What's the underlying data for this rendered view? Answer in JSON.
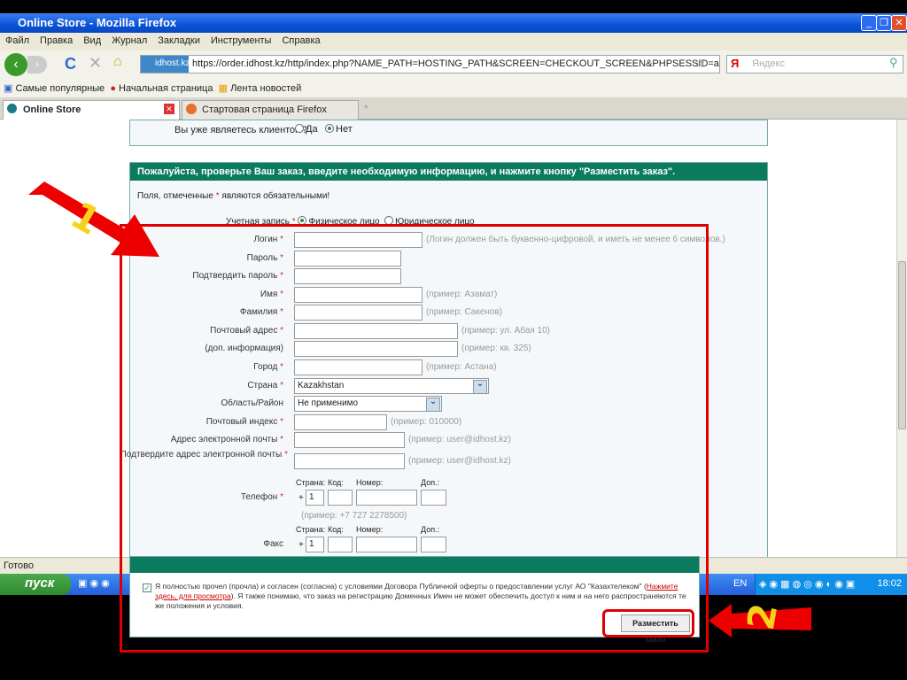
{
  "window": {
    "title": "Online Store - Mozilla Firefox"
  },
  "menu": [
    "Файл",
    "Правка",
    "Вид",
    "Журнал",
    "Закладки",
    "Инструменты",
    "Справка"
  ],
  "nav": {
    "site_badge": "idhost.kz",
    "url": "https://order.idhost.kz/http/index.php?NAME_PATH=HOSTING_PATH&SCREEN=CHECKOUT_SCREEN&PHPSESSID=afbb8387bcd36a9a3d8f16e11",
    "search_placeholder": "Яндекс",
    "search_engine": "Я"
  },
  "bookmarks": [
    "Самые популярные",
    "Начальная страница",
    "Лента новостей"
  ],
  "tabs": [
    "Online Store",
    "Стартовая страница Firefox"
  ],
  "client": {
    "question": "Вы уже являетесь клиентом?",
    "yes": "Да",
    "no": "Нет",
    "selected": "Нет"
  },
  "form": {
    "header": "Пожалуйста, проверьте Ваш заказ, введите необходимую информацию, и нажмите кнопку \"Разместить заказ\".",
    "required_note_pre": "Поля, отмеченные ",
    "required_note_star": "*",
    "required_note_post": " являются обязательными!",
    "account_label": "Учетная запись",
    "account_individual": "Физическое лицо",
    "account_company": "Юридическое лицо",
    "fields": [
      {
        "label": "Логин",
        "req": true,
        "hint": "(Логин должен быть буквенно-цифровой, и иметь не менее 6 символов.)"
      },
      {
        "label": "Пароль",
        "req": true,
        "hint": ""
      },
      {
        "label": "Подтвердить пароль",
        "req": true,
        "hint": ""
      },
      {
        "label": "Имя",
        "req": true,
        "hint": "(пример: Азамат)"
      },
      {
        "label": "Фамилия",
        "req": true,
        "hint": "(пример: Сакенов)"
      },
      {
        "label": "Почтовый адрес",
        "req": true,
        "hint": "(пример: ул. Абая 10)"
      },
      {
        "label": "(доп. информация)",
        "req": false,
        "hint": "(пример: кв. 325)"
      },
      {
        "label": "Город",
        "req": true,
        "hint": "(пример: Астана)"
      },
      {
        "label": "Страна",
        "req": true,
        "value": "Kazakhstan",
        "hint": ""
      },
      {
        "label": "Область/Район",
        "req": false,
        "value": "Не применимо",
        "hint": ""
      },
      {
        "label": "Почтовый индекс",
        "req": true,
        "hint": "(пример: 010000)"
      },
      {
        "label": "Адрес электронной почты",
        "req": true,
        "hint": "(пример: user@idhost.kz)"
      },
      {
        "label": "Подтвердите адрес электронной почты",
        "req": true,
        "hint": "(пример: user@idhost.kz)"
      }
    ],
    "phone_cols": [
      "Страна:",
      "Код:",
      "Номер:",
      "Доп.:"
    ],
    "phone_label": "Телефон",
    "fax_label": "Факс",
    "plus": "+",
    "country_code": "1",
    "phone_hint": "(пример: +7 727 2278500)"
  },
  "agreement": {
    "text1": "Я полностью прочел (прочла) и согласен (согласна) с условиями Договора Публичной оферты о предоставлении услуг АО \"Казахтелеком\" (",
    "link": "Нажмите здесь, для просмотра",
    "text2": "). Я также понимаю, что заказ на регистрацию Доменных Имен не может обеспечить доступ к ним и на него распространяются те же положения и условия.",
    "checked": true,
    "submit": "Разместить заказ"
  },
  "status": "Готово",
  "taskbar": {
    "start": "пуск",
    "lang": "EN",
    "clock": "18:02"
  },
  "annotations": {
    "step1": "1",
    "step2": "2"
  }
}
